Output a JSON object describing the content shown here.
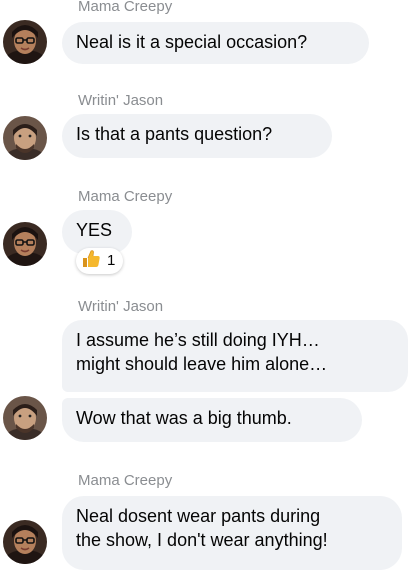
{
  "messages": [
    {
      "sender": "Mama Creepy",
      "lines": [
        "Neal is it a special occasion?"
      ]
    },
    {
      "sender": "Writin' Jason",
      "lines": [
        "Is that a pants question?"
      ]
    },
    {
      "sender": "Mama Creepy",
      "lines": [
        "YES"
      ],
      "reaction": {
        "icon": "thumbs-up-icon",
        "count": "1"
      }
    },
    {
      "sender": "Writin' Jason",
      "lines": [
        "I assume he’s still doing IYH…",
        "might should leave him alone…"
      ]
    },
    {
      "lines": [
        "Wow that was a big thumb."
      ]
    },
    {
      "sender": "Mama Creepy",
      "lines": [
        "Neal dosent wear pants during",
        "the show, I don't wear anything!"
      ]
    }
  ],
  "colors": {
    "bubble": "#f0f2f5",
    "sender_text": "#8a8d91",
    "message_text": "#050505",
    "reaction_thumb": "#f5b82e"
  }
}
